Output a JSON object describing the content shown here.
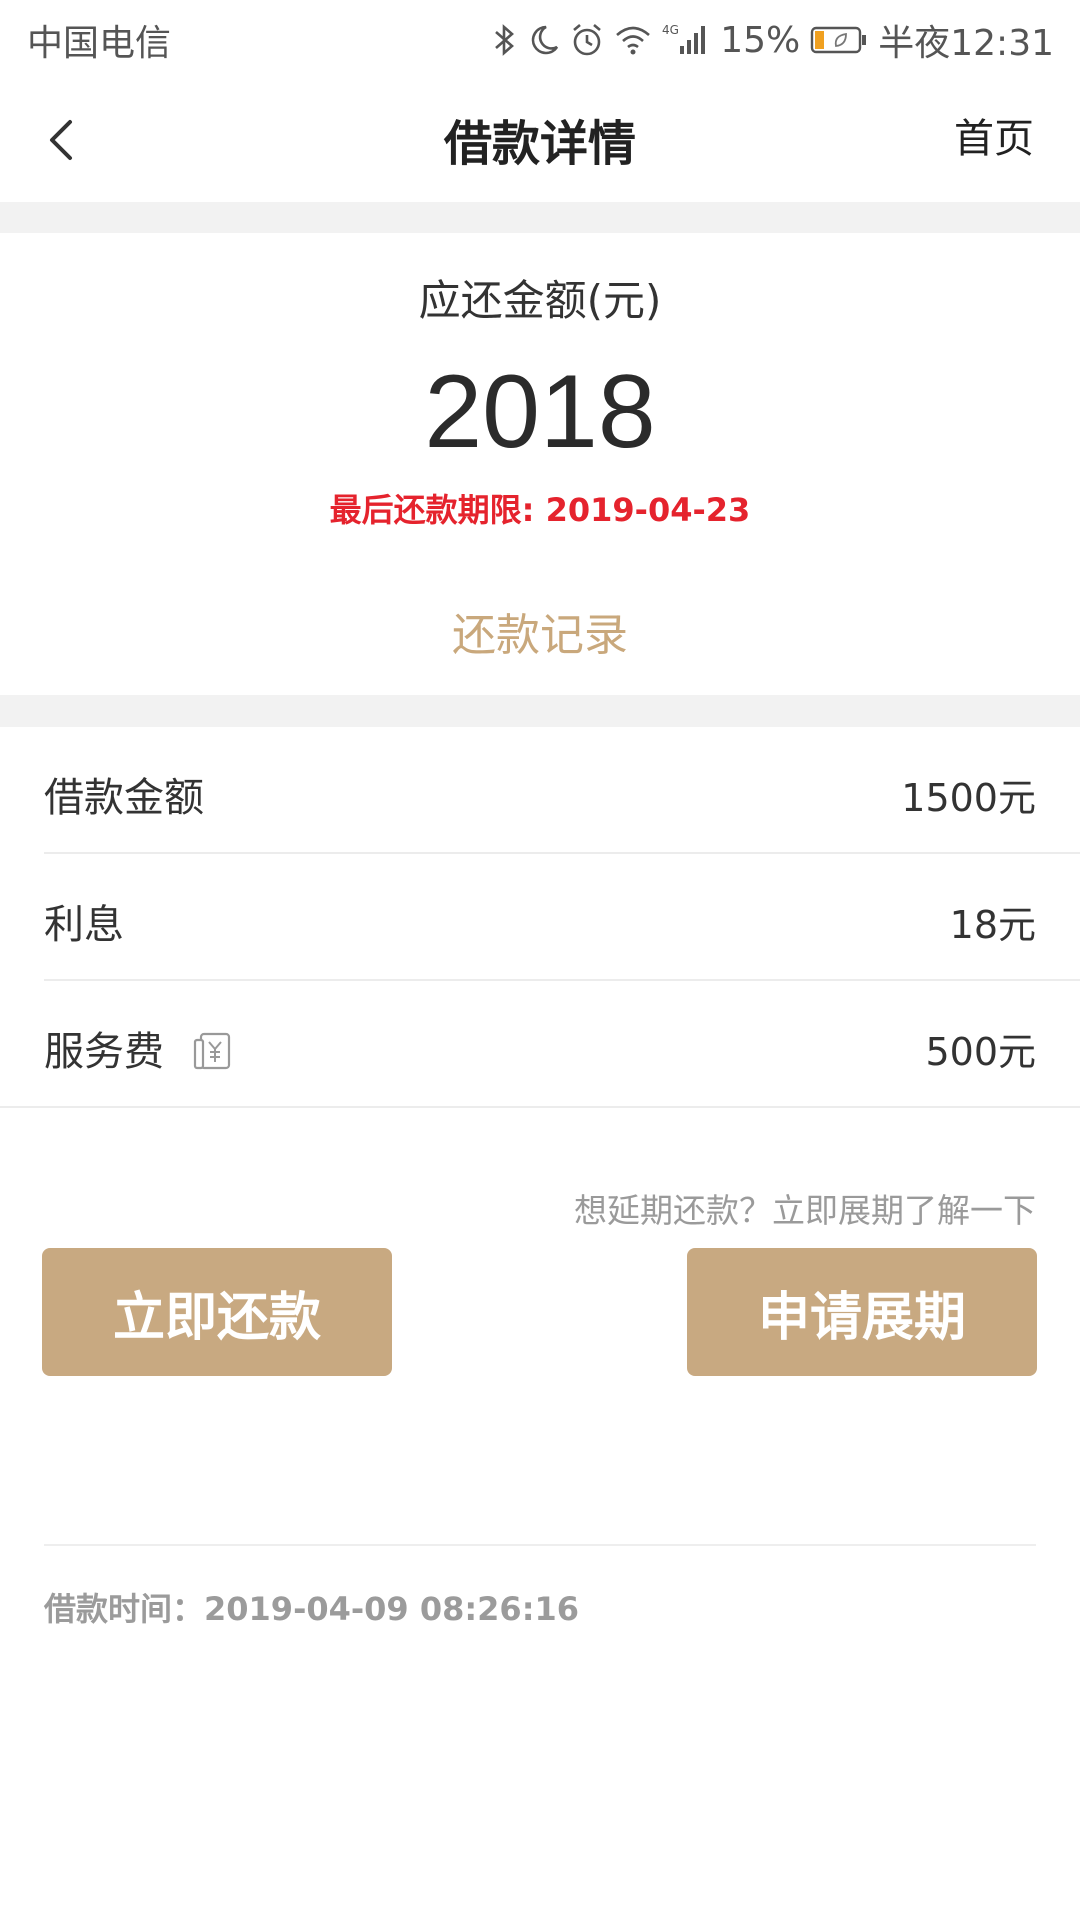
{
  "status_bar": {
    "carrier": "中国电信",
    "battery_percent": "15%",
    "time": "半夜12:31",
    "network": "4G"
  },
  "header": {
    "title": "借款详情",
    "home_label": "首页"
  },
  "summary": {
    "due_label": "应还金额(元)",
    "due_amount": "2018",
    "deadline": "最后还款期限: 2019-04-23",
    "records_link": "还款记录",
    "deadline_color": "#e5232d",
    "accent_color": "#c9a87c"
  },
  "details": {
    "loan_amount_label": "借款金额",
    "loan_amount_value": "1500元",
    "interest_label": "利息",
    "interest_value": "18元",
    "service_fee_label": "服务费",
    "service_fee_value": "500元"
  },
  "actions": {
    "extend_hint": "想延期还款？立即展期了解一下",
    "repay_button": "立即还款",
    "extend_button": "申请展期",
    "button_color": "#c8a981"
  },
  "footer": {
    "loan_time": "借款时间：2019-04-09 08:26:16"
  }
}
